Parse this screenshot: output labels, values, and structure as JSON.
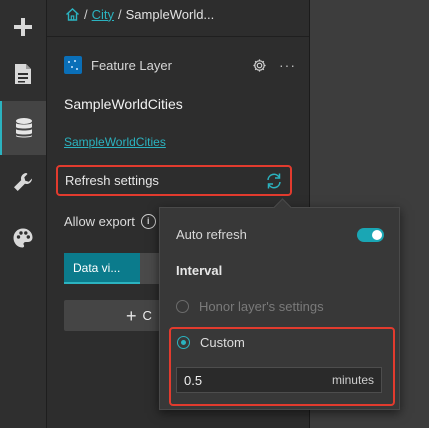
{
  "breadcrumb": {
    "home_icon": "home-icon",
    "separator": "/",
    "city_link": "City",
    "current": "SampleWorld..."
  },
  "rail": {
    "items": [
      {
        "icon": "plus-icon"
      },
      {
        "icon": "page-icon"
      },
      {
        "icon": "database-icon",
        "active": true
      },
      {
        "icon": "wrench-icon"
      },
      {
        "icon": "palette-icon"
      }
    ],
    "accent": "#2bb3c0"
  },
  "layer": {
    "type_label": "Feature Layer",
    "name": "SampleWorldCities",
    "link": "SampleWorldCities"
  },
  "refresh": {
    "label": "Refresh settings"
  },
  "allow_export": {
    "label": "Allow export"
  },
  "tabs": {
    "active_label": "Data vi..."
  },
  "add_button": {
    "label": "C"
  },
  "popover": {
    "auto_refresh_label": "Auto refresh",
    "auto_refresh_on": true,
    "interval_title": "Interval",
    "honor_label": "Honor layer's settings",
    "custom_label": "Custom",
    "value": "0.5",
    "unit": "minutes"
  },
  "colors": {
    "highlight": "#e23b2e",
    "accent": "#2bb3c0",
    "tab_active": "#0b7b8c"
  }
}
